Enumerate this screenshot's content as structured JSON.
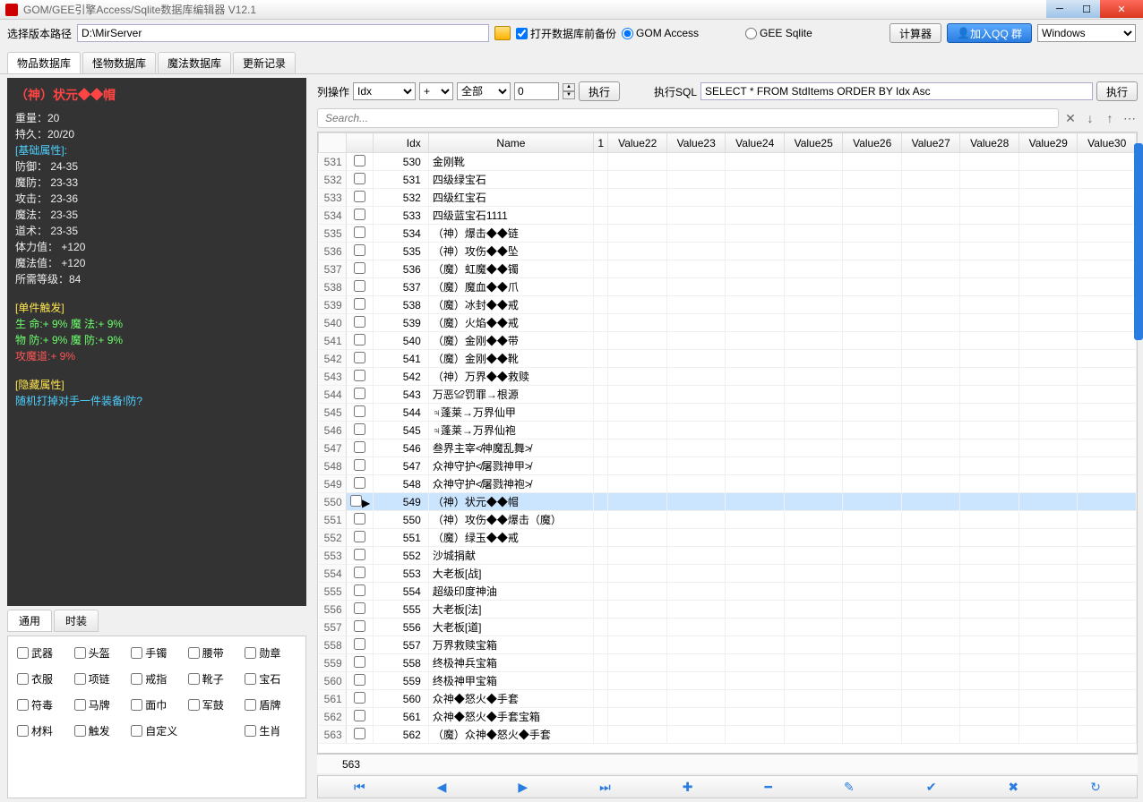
{
  "window": {
    "title": "GOM/GEE引擎Access/Sqlite数据库编辑器 V12.1"
  },
  "toolbar": {
    "path_label": "选择版本路径",
    "path_value": "D:\\MirServer",
    "backup_label": "打开数据库前备份",
    "gom_label": "GOM Access",
    "gee_label": "GEE Sqlite",
    "calc_label": "计算器",
    "qq_label": "加入QQ 群",
    "os_value": "Windows"
  },
  "tabs": [
    "物品数据库",
    "怪物数据库",
    "魔法数据库",
    "更新记录"
  ],
  "preview": {
    "title": "（神）状元◆◆帽",
    "weight": "重量：20",
    "dura": "持久：20/20",
    "base_hdr": "[基础属性]:",
    "stats": [
      "防御：     24-35",
      "魔防：     23-33",
      "攻击：     23-36",
      "魔法：     23-35",
      "道术：     23-35",
      "体力值：    +120",
      "魔法值：    +120",
      "所需等级：84"
    ],
    "trig_hdr": "[单件触发]",
    "trig1": "生   命:+ 9% 魔   法:+ 9%",
    "trig2": "物   防:+ 9% 魔   防:+ 9%",
    "trig3": "攻魔道:+ 9%",
    "hide_hdr": "[隐藏属性]",
    "hide_txt": "随机打掉对手一件装备!防?"
  },
  "subtabs": [
    "通用",
    "时装"
  ],
  "filters": [
    "武器",
    "头盔",
    "手镯",
    "腰带",
    "勋章",
    "衣服",
    "项链",
    "戒指",
    "靴子",
    "宝石",
    "符毒",
    "马牌",
    "面巾",
    "军鼓",
    "盾牌",
    "材料",
    "触发",
    "自定义",
    "",
    "生肖"
  ],
  "colops": {
    "label": "列操作",
    "col_sel": "Idx",
    "plus": "+",
    "all": "全部",
    "num": "0",
    "exec": "执行",
    "sql_label": "执行SQL",
    "sql_value": "SELECT * FROM StdItems ORDER BY Idx Asc",
    "exec2": "执行"
  },
  "search_placeholder": "Search...",
  "columns": [
    "",
    "",
    "Idx",
    "Name",
    "1",
    "Value22",
    "Value23",
    "Value24",
    "Value25",
    "Value26",
    "Value27",
    "Value28",
    "Value29",
    "Value30"
  ],
  "rows": [
    {
      "n": 531,
      "idx": 530,
      "name": "金刚靴"
    },
    {
      "n": 532,
      "idx": 531,
      "name": "四级绿宝石"
    },
    {
      "n": 533,
      "idx": 532,
      "name": "四级红宝石"
    },
    {
      "n": 534,
      "idx": 533,
      "name": "四级蓝宝石1111"
    },
    {
      "n": 535,
      "idx": 534,
      "name": "（神）爆击◆◆链"
    },
    {
      "n": 536,
      "idx": 535,
      "name": "（神）攻伤◆◆坠"
    },
    {
      "n": 537,
      "idx": 536,
      "name": "（魔）虹魔◆◆镯"
    },
    {
      "n": 538,
      "idx": 537,
      "name": "（魔）魔血◆◆爪"
    },
    {
      "n": 539,
      "idx": 538,
      "name": "（魔）冰封◆◆戒"
    },
    {
      "n": 540,
      "idx": 539,
      "name": "（魔）火焰◆◆戒"
    },
    {
      "n": 541,
      "idx": 540,
      "name": "（魔）金刚◆◆带"
    },
    {
      "n": 542,
      "idx": 541,
      "name": "（魔）金刚◆◆靴"
    },
    {
      "n": 543,
      "idx": 542,
      "name": "（神）万界◆◆救赎"
    },
    {
      "n": 544,
      "idx": 543,
      "name": "万恶≌罚罪→根源"
    },
    {
      "n": 545,
      "idx": 544,
      "name": "♃蓬莱→万界仙甲"
    },
    {
      "n": 546,
      "idx": 545,
      "name": "♃蓬莱→万界仙袍"
    },
    {
      "n": 547,
      "idx": 546,
      "name": "叁界主宰≮神魔乱舞≯"
    },
    {
      "n": 548,
      "idx": 547,
      "name": "众神守护≮屠戮神甲≯"
    },
    {
      "n": 549,
      "idx": 548,
      "name": "众神守护≮屠戮神袍≯"
    },
    {
      "n": 550,
      "idx": 549,
      "name": "（神）状元◆◆帽",
      "sel": true
    },
    {
      "n": 551,
      "idx": 550,
      "name": "（神）攻伤◆◆爆击（魔）"
    },
    {
      "n": 552,
      "idx": 551,
      "name": "（魔）绿玉◆◆戒"
    },
    {
      "n": 553,
      "idx": 552,
      "name": "沙城捐献"
    },
    {
      "n": 554,
      "idx": 553,
      "name": "大老板[战]"
    },
    {
      "n": 555,
      "idx": 554,
      "name": "超级印度神油"
    },
    {
      "n": 556,
      "idx": 555,
      "name": "大老板[法]"
    },
    {
      "n": 557,
      "idx": 556,
      "name": "大老板[道]"
    },
    {
      "n": 558,
      "idx": 557,
      "name": "万界救赎宝箱"
    },
    {
      "n": 559,
      "idx": 558,
      "name": "终极神兵宝箱"
    },
    {
      "n": 560,
      "idx": 559,
      "name": "终极神甲宝箱"
    },
    {
      "n": 561,
      "idx": 560,
      "name": "众神◆怒火◆手套"
    },
    {
      "n": 562,
      "idx": 561,
      "name": "众神◆怒火◆手套宝箱"
    },
    {
      "n": 563,
      "idx": 562,
      "name": "（魔）众神◆怒火◆手套"
    }
  ],
  "footer_count": "563"
}
